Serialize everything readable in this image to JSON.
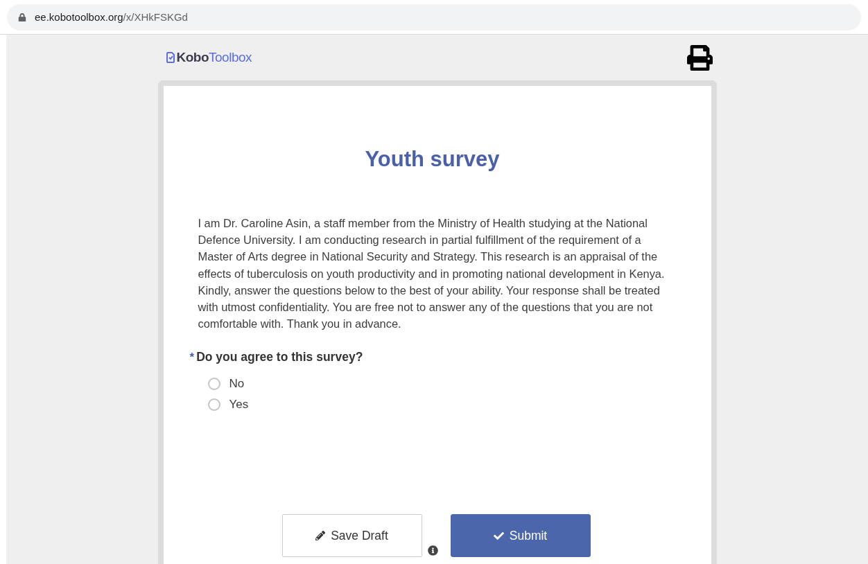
{
  "browser": {
    "url_parts": [
      "ee.kobotoolbox.org",
      "/x/XHkFSKGd"
    ]
  },
  "header": {
    "logo_parts": [
      "Kobo",
      "Toolbox"
    ]
  },
  "form": {
    "title": "Youth survey",
    "intro": "I am Dr. Caroline Asin, a staff member from the Ministry of Health studying at the National Defence University. I am conducting research in partial fulfillment of the requirement of a Master of Arts degree in National Security and Strategy. This research is an appraisal of the effects of tuberculosis on youth productivity and in promoting national development in Kenya. Kindly, answer the questions below to the best of your ability. Your response shall be treated with utmost confidentiality. You are free not to answer any of the questions that you are not comfortable with. Thank you in advance.",
    "question": {
      "required_mark": "*",
      "label": "Do you agree to this survey?",
      "options": [
        {
          "label": "No",
          "selected": false
        },
        {
          "label": "Yes",
          "selected": false
        }
      ]
    },
    "buttons": {
      "save_draft": "Save Draft",
      "submit": "Submit"
    }
  }
}
